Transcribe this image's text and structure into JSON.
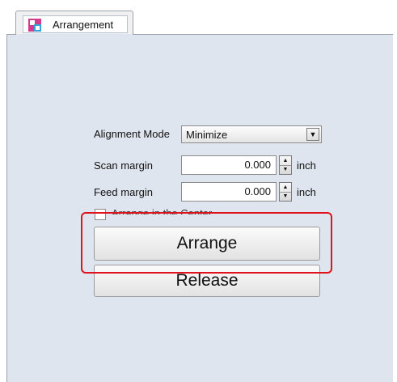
{
  "tab": {
    "label": "Arrangement",
    "icon": "arrangement-icon"
  },
  "alignment": {
    "label": "Alignment Mode",
    "selected": "Minimize"
  },
  "scan_margin": {
    "label": "Scan margin",
    "value": "0.000",
    "unit": "inch"
  },
  "feed_margin": {
    "label": "Feed margin",
    "value": "0.000",
    "unit": "inch"
  },
  "center": {
    "label": "Arrange in the Center",
    "checked": false
  },
  "buttons": {
    "arrange": "Arrange",
    "release": "Release"
  },
  "colors": {
    "highlight": "#e0121b",
    "panel": "#dfe5ee"
  }
}
